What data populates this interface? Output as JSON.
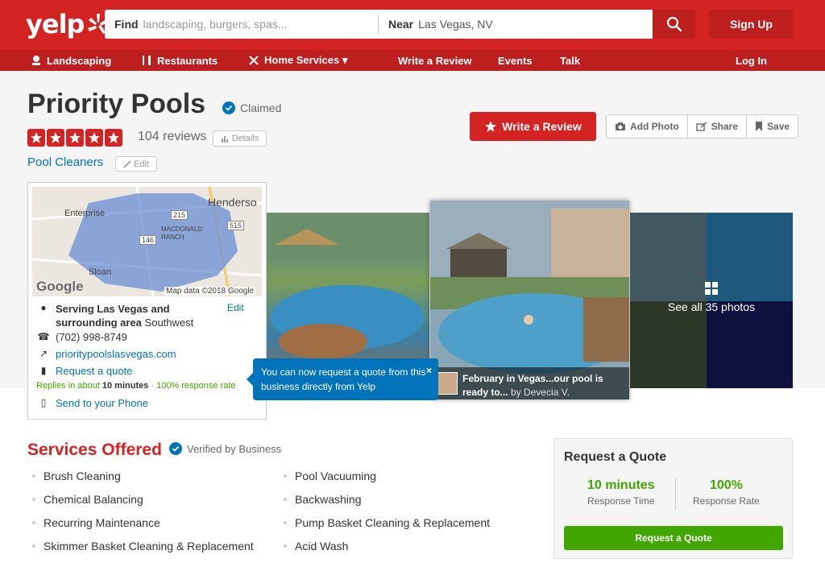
{
  "header": {
    "logo": "yelp",
    "find_label": "Find",
    "find_placeholder": "landscaping, burgers, spas...",
    "near_label": "Near",
    "near_value": "Las Vegas, NV",
    "signup_label": "Sign Up",
    "search_icon": "search-icon"
  },
  "nav": {
    "items": [
      {
        "label": "Landscaping",
        "icon": "landscaping-icon"
      },
      {
        "label": "Restaurants",
        "icon": "fork-knife-icon"
      },
      {
        "label": "Home Services ▾",
        "icon": "tools-icon"
      },
      {
        "label": "Write a Review"
      },
      {
        "label": "Events"
      },
      {
        "label": "Talk"
      }
    ],
    "login_label": "Log In"
  },
  "business": {
    "name": "Priority Pools",
    "claimed_label": "Claimed",
    "review_count": "104 reviews",
    "details_label": "Details",
    "rating": 5,
    "category": "Pool Cleaners",
    "edit_label": "Edit"
  },
  "actions": {
    "write_review": "Write a Review",
    "add_photo": "Add Photo",
    "share": "Share",
    "save": "Save"
  },
  "map": {
    "labels": {
      "enterprise": "Enterprise",
      "henderson": "Henderso",
      "macdonald": "MACDONALD\nRANCH",
      "sloan": "Sloan",
      "rt215": "215",
      "rt146": "146",
      "rt515": "515",
      "google": "Google",
      "map_data": "Map data ©2018 Google"
    }
  },
  "info": {
    "serving_bold": "Serving Las Vegas and surrounding area",
    "serving_rest": "Southwest",
    "edit": "Edit",
    "phone": "(702) 998-8749",
    "website": "prioritypoolslasvegas.com",
    "request_quote": "Request a quote",
    "replies_pre": "Replies in about",
    "replies_time": "10 minutes",
    "replies_rate": "· 100% response rate",
    "send_phone": "Send to your Phone"
  },
  "tooltip": {
    "text": "You can now request a quote from this business directly from Yelp",
    "close": "×"
  },
  "photos": {
    "caption_bold": "February in Vegas...our pool is ready to...",
    "caption_by": "by Devecia V.",
    "see_all": "See all 35 photos"
  },
  "services": {
    "title": "Services Offered",
    "verified": "Verified by Business",
    "left": [
      "Brush Cleaning",
      "Chemical Balancing",
      "Recurring Maintenance",
      "Skimmer Basket Cleaning & Replacement"
    ],
    "right": [
      "Pool Vacuuming",
      "Backwashing",
      "Pump Basket Cleaning & Replacement",
      "Acid Wash"
    ]
  },
  "quote_card": {
    "title": "Request a Quote",
    "stat1_value": "10 minutes",
    "stat1_label": "Response Time",
    "stat2_value": "100%",
    "stat2_label": "Response Rate",
    "button": "Request a Quote"
  },
  "colors": {
    "brand": "#d32323",
    "link": "#0073bb",
    "success": "#41a700"
  }
}
